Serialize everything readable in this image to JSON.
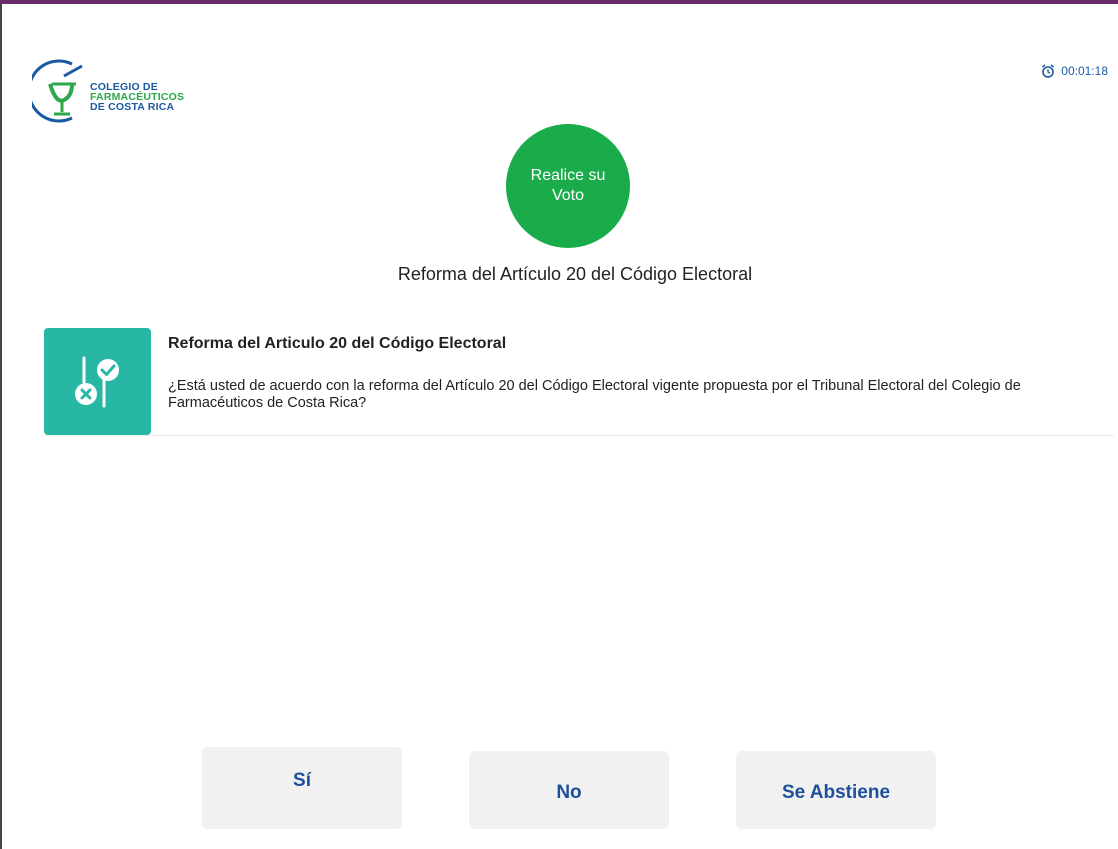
{
  "header": {
    "logo": {
      "line1": "COLEGIO DE",
      "line2": "FARMACÉUTICOS",
      "line3": "DE COSTA RICA",
      "icon": "pharmacy-logo-icon",
      "colors": {
        "blue": "#1b5aa3",
        "green": "#2aa84a"
      }
    },
    "timer": {
      "icon": "alarm-clock-icon",
      "value": "00:01:18"
    }
  },
  "vote_badge": {
    "label": "Realice su Voto",
    "color": "#1aab4b"
  },
  "ballot": {
    "title": "Reforma del Artículo 20 del Código Electoral",
    "question": {
      "icon": "vote-choice-icon",
      "icon_bg": "#29b7a5",
      "title": "Reforma del Articulo 20 del Código Electoral",
      "text": "¿Está usted de acuerdo con la reforma del Artículo 20 del Código Electoral vigente propuesta por el Tribunal Electoral del Colegio de Farmacéuticos de Costa Rica?"
    }
  },
  "options": {
    "yes": "Sí",
    "no": "No",
    "abstain": "Se Abstiene",
    "text_color": "#1e4f9c"
  },
  "accent": {
    "top_bar": "#6b2c6b"
  }
}
